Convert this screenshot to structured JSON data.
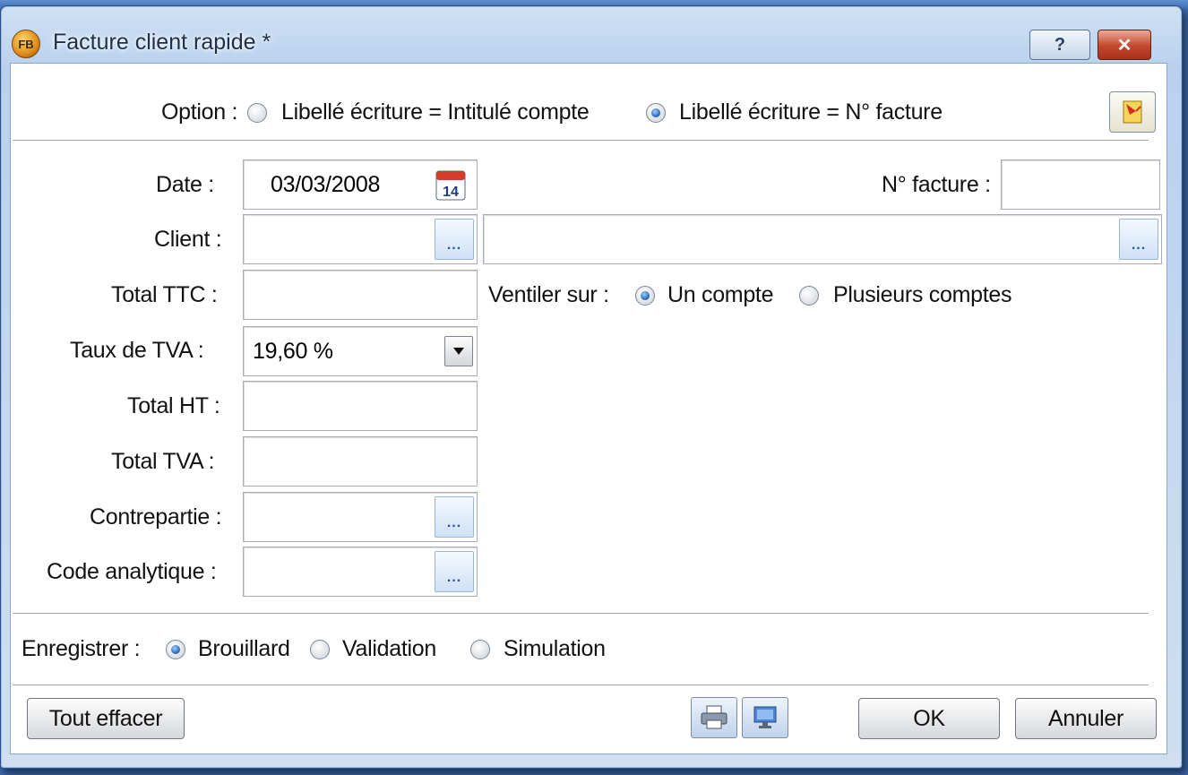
{
  "window": {
    "title": "Facture client rapide *",
    "app_icon_text": "FB",
    "help_label": "?",
    "close_label": "✕"
  },
  "option": {
    "label": "Option :",
    "choices": [
      {
        "label": "Libellé écriture = Intitulé compte",
        "selected": false
      },
      {
        "label": "Libellé écriture = N° facture",
        "selected": true
      }
    ]
  },
  "form": {
    "date_label": "Date :",
    "date_value": "03/03/2008",
    "invoice_label": "N° facture :",
    "invoice_value": "",
    "client_label": "Client :",
    "client_code": "",
    "client_name": "",
    "total_ttc_label": "Total TTC :",
    "total_ttc_value": "",
    "ventiler_label": "Ventiler sur :",
    "ventiler_choices": [
      {
        "label": "Un compte",
        "selected": true
      },
      {
        "label": "Plusieurs comptes",
        "selected": false
      }
    ],
    "tva_rate_label": "Taux de TVA :",
    "tva_rate_value": "19,60 %",
    "total_ht_label": "Total HT :",
    "total_ht_value": "",
    "total_tva_label": "Total TVA :",
    "total_tva_value": "",
    "contrepartie_label": "Contrepartie :",
    "contrepartie_value": "",
    "code_analytique_label": "Code analytique :",
    "code_analytique_value": ""
  },
  "enregistrer": {
    "label": "Enregistrer :",
    "choices": [
      {
        "label": "Brouillard",
        "selected": true
      },
      {
        "label": "Validation",
        "selected": false
      },
      {
        "label": "Simulation",
        "selected": false
      }
    ]
  },
  "buttons": {
    "clear_all": "Tout effacer",
    "ok": "OK",
    "cancel": "Annuler",
    "ellipsis": "..."
  },
  "calendar_icon_day": "14",
  "colors": {
    "title_bar": "#b9d1ee",
    "close_button": "#c3472c",
    "radio_selected": "#1d5fb8"
  }
}
